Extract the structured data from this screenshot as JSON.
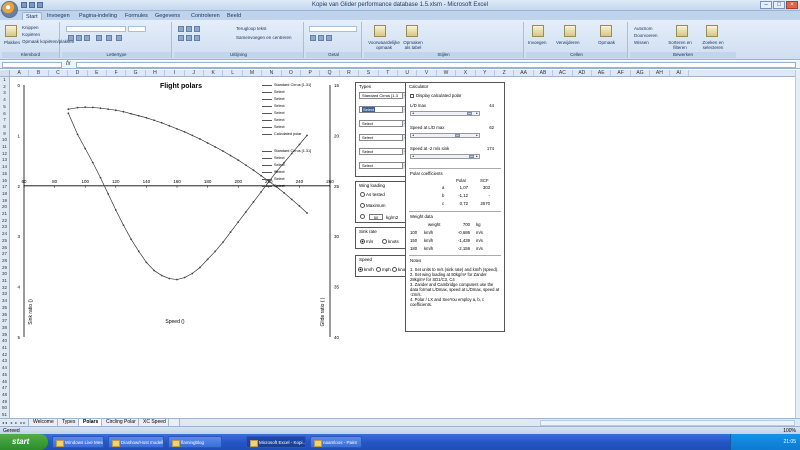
{
  "window": {
    "title": "Kopie van Glider performance database 1.5.xlsm - Microsoft Excel"
  },
  "ribbon_tabs": [
    "Start",
    "Invoegen",
    "Pagina-indeling",
    "Formules",
    "Gegevens",
    "Controleren",
    "Beeld"
  ],
  "ribbon": {
    "clipboard": {
      "paste": "Plakken",
      "cut": "Knippen",
      "copy": "Kopiëren",
      "format_painter": "Opmaak kopiëren/plakken",
      "group": "Klembord"
    },
    "font": {
      "group": "Lettertype"
    },
    "alignment": {
      "wrap": "Terugloop tekst",
      "merge": "Samenvoegen en centreren",
      "group": "Uitlijning"
    },
    "number": {
      "group": "Getal"
    },
    "styles": {
      "conditional": "Voorwaardelijke opmaak",
      "table": "Opmaken als tabel",
      "group": "Stijlen"
    },
    "cells": {
      "insert": "Invoegen",
      "delete": "Verwijderen",
      "format": "Opmaak",
      "group": "Cellen"
    },
    "editing": {
      "autosum": "AutoSom",
      "fill": "Doorvoeren",
      "clear": "Wissen",
      "sort": "Sorteren en filteren",
      "find": "Zoeken en selecteren",
      "group": "Bewerken"
    }
  },
  "formula_bar": {
    "fx": "fx",
    "name_box": "",
    "content": ""
  },
  "columns": [
    "A",
    "B",
    "C",
    "D",
    "E",
    "F",
    "G",
    "H",
    "I",
    "J",
    "K",
    "L",
    "M",
    "N",
    "O",
    "P",
    "Q",
    "R",
    "S",
    "T",
    "U",
    "V",
    "W",
    "X",
    "Y",
    "Z",
    "AA",
    "AB",
    "AC",
    "AD",
    "AE",
    "AF",
    "AG",
    "AH",
    "AI"
  ],
  "rows": [
    "1",
    "2",
    "3",
    "4",
    "5",
    "6",
    "7",
    "8",
    "9",
    "10",
    "11",
    "12",
    "13",
    "14",
    "15",
    "16",
    "17",
    "18",
    "19",
    "20",
    "21",
    "22",
    "23",
    "24",
    "25",
    "26",
    "27",
    "28",
    "29",
    "30",
    "31",
    "32",
    "33",
    "34",
    "35",
    "36",
    "37",
    "38",
    "39",
    "40",
    "41",
    "42",
    "43",
    "44",
    "45",
    "46",
    "47",
    "48",
    "49",
    "50",
    "51"
  ],
  "chart": {
    "title": "Flight polars",
    "xlabel": "Speed ()",
    "ylabel_left": "Sink ratio ()",
    "ylabel_right": "Glide ratio ( )",
    "legend": [
      "Standard Cirrus [1.31]",
      "Select",
      "Select",
      "Select",
      "Select",
      "Select",
      "Select",
      "Calculated polar",
      "Standard Cirrus [1.31]",
      "Select",
      "Select",
      "Select",
      "Select",
      "Select"
    ]
  },
  "chart_data": {
    "type": "line",
    "title": "Flight polars",
    "xlabel": "Speed ()",
    "ylabel": "Sink ratio ()",
    "y2label": "Glide ratio ( )",
    "xlim": [
      60,
      260
    ],
    "xticks": [
      60,
      80,
      100,
      120,
      140,
      160,
      180,
      200,
      220,
      240,
      260
    ],
    "ylim_left": [
      0,
      5
    ],
    "yticks_left": [
      "0",
      "1",
      "2",
      "3",
      "4",
      "5"
    ],
    "ylim_right": [
      15,
      40
    ],
    "yticks_right": [
      "15",
      "20",
      "25",
      "30",
      "35",
      "40"
    ],
    "series": [
      {
        "name": "Standard Cirrus [1.31]",
        "axis": "left",
        "x": [
          89,
          95,
          100,
          105,
          110,
          115,
          120,
          125,
          130,
          135,
          140,
          145,
          150,
          155,
          160,
          165,
          170,
          175,
          180,
          185,
          190,
          195,
          200,
          205,
          210,
          215,
          220,
          225,
          230,
          235,
          240,
          245
        ],
        "values": [
          0.48,
          0.45,
          0.44,
          0.445,
          0.46,
          0.48,
          0.5,
          0.53,
          0.57,
          0.61,
          0.65,
          0.7,
          0.75,
          0.81,
          0.87,
          0.93,
          1.0,
          1.07,
          1.15,
          1.23,
          1.31,
          1.4,
          1.49,
          1.59,
          1.69,
          1.8,
          1.91,
          2.02,
          2.14,
          2.27,
          2.4,
          2.54
        ]
      },
      {
        "name": "Standard Cirrus [1.31]",
        "axis": "right",
        "x": [
          89,
          95,
          100,
          105,
          110,
          115,
          120,
          125,
          130,
          135,
          140,
          145,
          150,
          155,
          160,
          165,
          170,
          175,
          180,
          185,
          190,
          195,
          200,
          205,
          210,
          215,
          220,
          225,
          230,
          235,
          240,
          245
        ],
        "values": [
          17.8,
          19.9,
          21.3,
          22.7,
          24.2,
          25.8,
          27.4,
          28.9,
          30.3,
          31.5,
          32.6,
          33.4,
          33.9,
          34.2,
          34.3,
          34.1,
          33.7,
          33.1,
          32.3,
          31.5,
          30.6,
          29.6,
          28.6,
          27.6,
          26.6,
          25.6,
          24.6,
          23.6,
          22.7,
          21.8,
          20.9,
          20.0
        ]
      }
    ]
  },
  "types_panel": {
    "title": "Types",
    "selects": [
      "Standard Cirrus [1.3",
      "Select",
      "Select",
      "Select",
      "Select",
      "Select"
    ]
  },
  "wing_loading": {
    "title": "Wing loading",
    "as_tested": "As tested",
    "maximum": "Maximum",
    "value": "50",
    "unit": "kg/m2"
  },
  "sink_rate": {
    "title": "Sink rate",
    "opt1": "m/s",
    "opt2": "knots"
  },
  "speed_panel": {
    "title": "Speed",
    "opt1": "km/h",
    "opt2": "mph",
    "opt3": "knots"
  },
  "calculator": {
    "title": "Calculator",
    "display_label": "Display calculated polar",
    "ld_label": "L/D max",
    "ld_value": "44",
    "speed_ld_label": "Speed at L/D max",
    "speed_ld_value": "62",
    "speed_sink_label": "Speed at -2 m/s sink",
    "speed_sink_value": "174",
    "polar_label": "Polar coefficients",
    "col1": "Polar",
    "col2": "SCF",
    "coef_a_label": "a",
    "coef_a_polar": "1,07",
    "coef_a_scf": "303",
    "coef_b_label": "b",
    "coef_b_polar": "-1,12",
    "coef_b_scf": "-",
    "coef_c_label": "c",
    "coef_c_polar": "0,72",
    "coef_c_scf": "2570",
    "weight_title": "Weight data",
    "weight_label": "weight",
    "weight_value": "700",
    "weight_unit": "kg",
    "r1_speed": "100",
    "r1_unit": "km/h",
    "r1_sink": "-0,686",
    "r1_sunit": "m/s",
    "r2_speed": "150",
    "r2_unit": "km/h",
    "r2_sink": "-1,439",
    "r2_sunit": "m/s",
    "r3_speed": "180",
    "r3_unit": "km/h",
    "r3_sink": "-2,159",
    "r3_sunit": "m/s",
    "notes_title": "Notes",
    "notes": [
      "1. Set units to m/s (sink rate) and km/h (speed).",
      "2. Set wing loading at 50kg/m² for Zander 28kg/m² for SD1/C3, C4",
      "3. Zander and Cambridge computers use the data format L/Dmax, speed at L/Dmax, speed at -2m/s.",
      "4. Polar / LX and SeeYou employ a, b, c coefficients."
    ]
  },
  "sheet_tabs": [
    "Welcome",
    "Types",
    "Polars",
    "Circling Polar",
    "XC Speed"
  ],
  "active_sheet": "Polars",
  "status": {
    "ready": "Gereed",
    "zoom": "100%"
  },
  "taskbar": {
    "start": "start",
    "buttons": [
      "Windows Live Messen...",
      "Diashow/Host modellen...",
      "flamingblog",
      "Microsoft Excel - Kopi...",
      "naamloos - Paint"
    ],
    "active": "Microsoft Excel - Kopi...",
    "clock": "21:05"
  }
}
